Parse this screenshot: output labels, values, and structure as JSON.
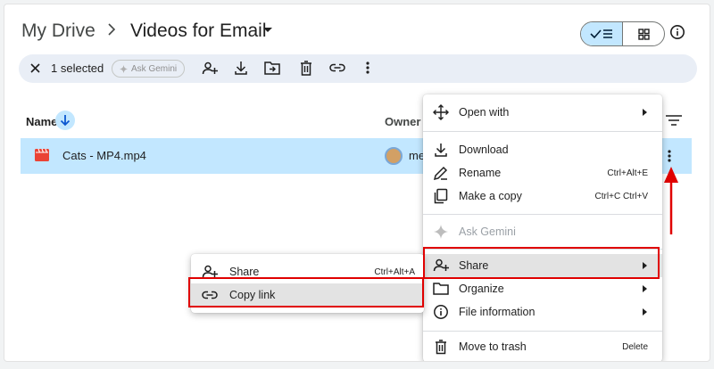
{
  "header": {
    "breadcrumb_root": "My Drive",
    "breadcrumb_sep_icon": "chevron-right-icon",
    "current_folder": "Videos for Email",
    "folder_caret_icon": "caret-down-icon",
    "view_list_icon": "check-list-icon",
    "view_grid_icon": "grid-icon",
    "info_icon": "info-icon"
  },
  "toolbar": {
    "selected_count": "1 selected",
    "gemini_label": "Ask Gemini",
    "actions": [
      "share-icon",
      "download-icon",
      "move-icon",
      "trash-icon",
      "link-icon",
      "more-vert-icon"
    ]
  },
  "list": {
    "col_name": "Name",
    "col_owner": "Owner",
    "files": [
      {
        "name": "Cats - MP4.mp4",
        "owner": "me",
        "type": "video"
      }
    ]
  },
  "context_menu": {
    "items": [
      {
        "label": "Open with",
        "icon": "open-with-icon",
        "submenu": true
      },
      {
        "label": "Download",
        "icon": "download-icon"
      },
      {
        "label": "Rename",
        "icon": "rename-icon",
        "shortcut": "Ctrl+Alt+E"
      },
      {
        "label": "Make a copy",
        "icon": "copy-icon",
        "shortcut": "Ctrl+C Ctrl+V"
      },
      {
        "label": "Ask Gemini",
        "icon": "gemini-icon",
        "disabled": true
      },
      {
        "label": "Share",
        "icon": "share-icon",
        "submenu": true,
        "highlighted": true
      },
      {
        "label": "Organize",
        "icon": "organize-icon",
        "submenu": true
      },
      {
        "label": "File information",
        "icon": "info-icon",
        "submenu": true
      },
      {
        "label": "Move to trash",
        "icon": "trash-icon",
        "shortcut": "Delete"
      }
    ]
  },
  "share_submenu": {
    "items": [
      {
        "label": "Share",
        "icon": "share-icon",
        "shortcut": "Ctrl+Alt+A"
      },
      {
        "label": "Copy link",
        "icon": "link-icon",
        "highlighted": true
      }
    ]
  },
  "colors": {
    "selection": "#c2e7ff",
    "toolbar_bg": "#e9eef6",
    "annotation_red": "#e00000",
    "menu_highlight": "#e3e3e3"
  }
}
